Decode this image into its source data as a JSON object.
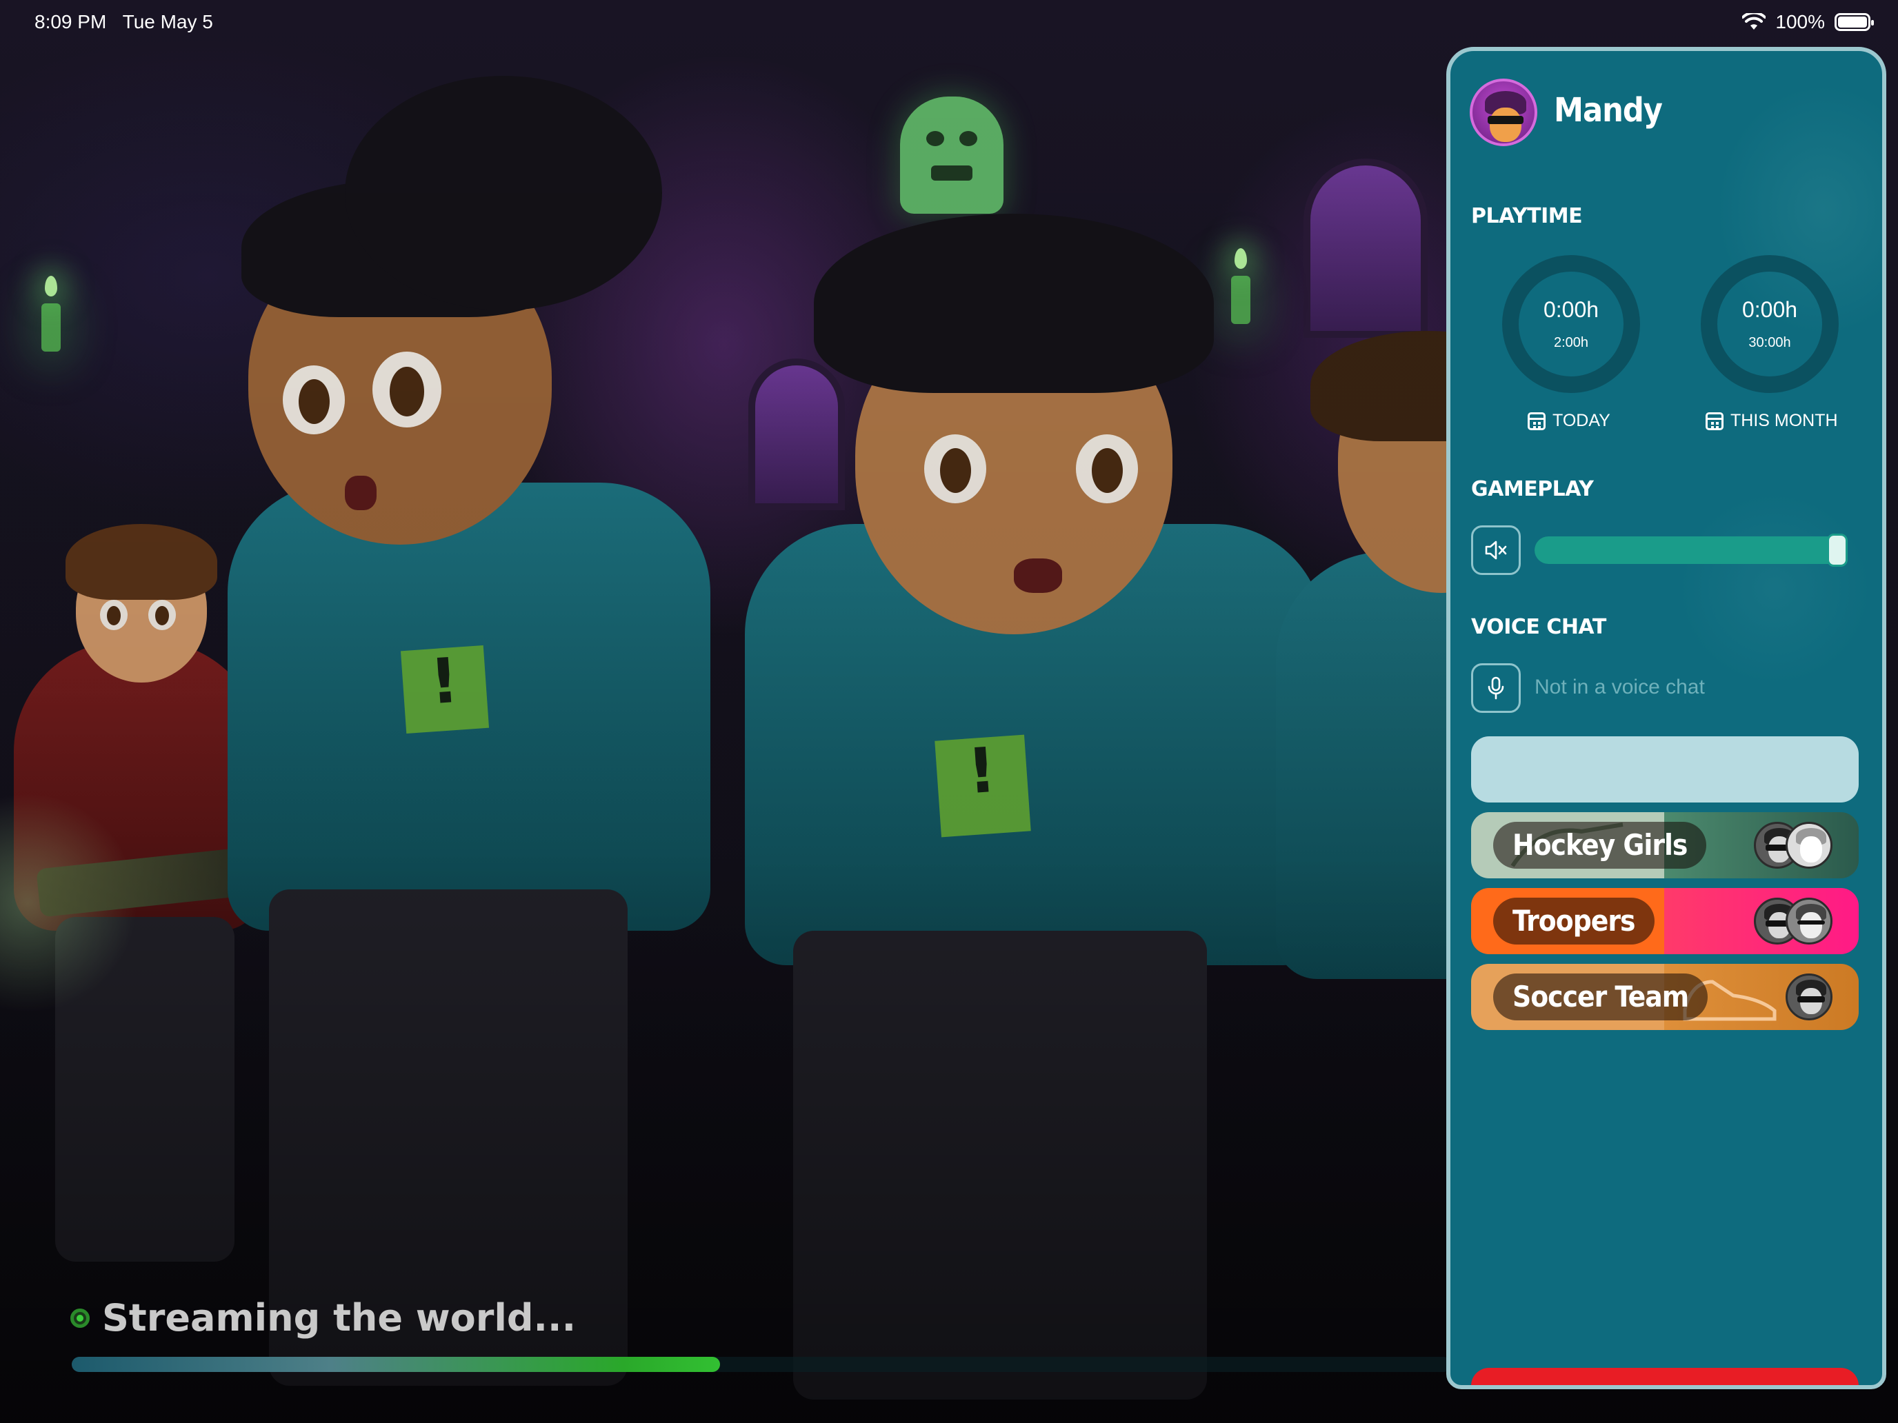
{
  "status_bar": {
    "time": "8:09 PM",
    "date": "Tue May 5",
    "battery": "100%",
    "wifi_icon": "wifi-icon",
    "battery_icon": "battery-icon"
  },
  "loading": {
    "text": "Streaming the world...",
    "progress": 0.47,
    "progress_color": "#32c032"
  },
  "panel": {
    "user": {
      "name": "Mandy",
      "avatar_icon": "user-avatar"
    },
    "playtime": {
      "title": "PLAYTIME",
      "today": {
        "used": "0:00h",
        "limit": "2:00h",
        "label": "TODAY"
      },
      "month": {
        "used": "0:00h",
        "limit": "30:00h",
        "label": "THIS MONTH"
      }
    },
    "gameplay": {
      "title": "GAMEPLAY",
      "volume_level": 1.0,
      "mute_icon": "speaker-mute-icon"
    },
    "voice_chat": {
      "title": "VOICE CHAT",
      "status": "Not in a voice chat",
      "mic_icon": "microphone-icon"
    },
    "teams": [
      {
        "name": "Hockey Girls",
        "color_left": "#b5cbb8",
        "color_right": "#3d6e5d",
        "members": 2
      },
      {
        "name": "Troopers",
        "color_left": "#ff6a1a",
        "color_right": "#ff1a7a",
        "members": 2
      },
      {
        "name": "Soccer Team",
        "color_left": "#e6a15a",
        "color_right": "#d9862c",
        "members": 1
      }
    ],
    "accent_color": "#0e6b7e",
    "danger_color": "#e81d25"
  }
}
